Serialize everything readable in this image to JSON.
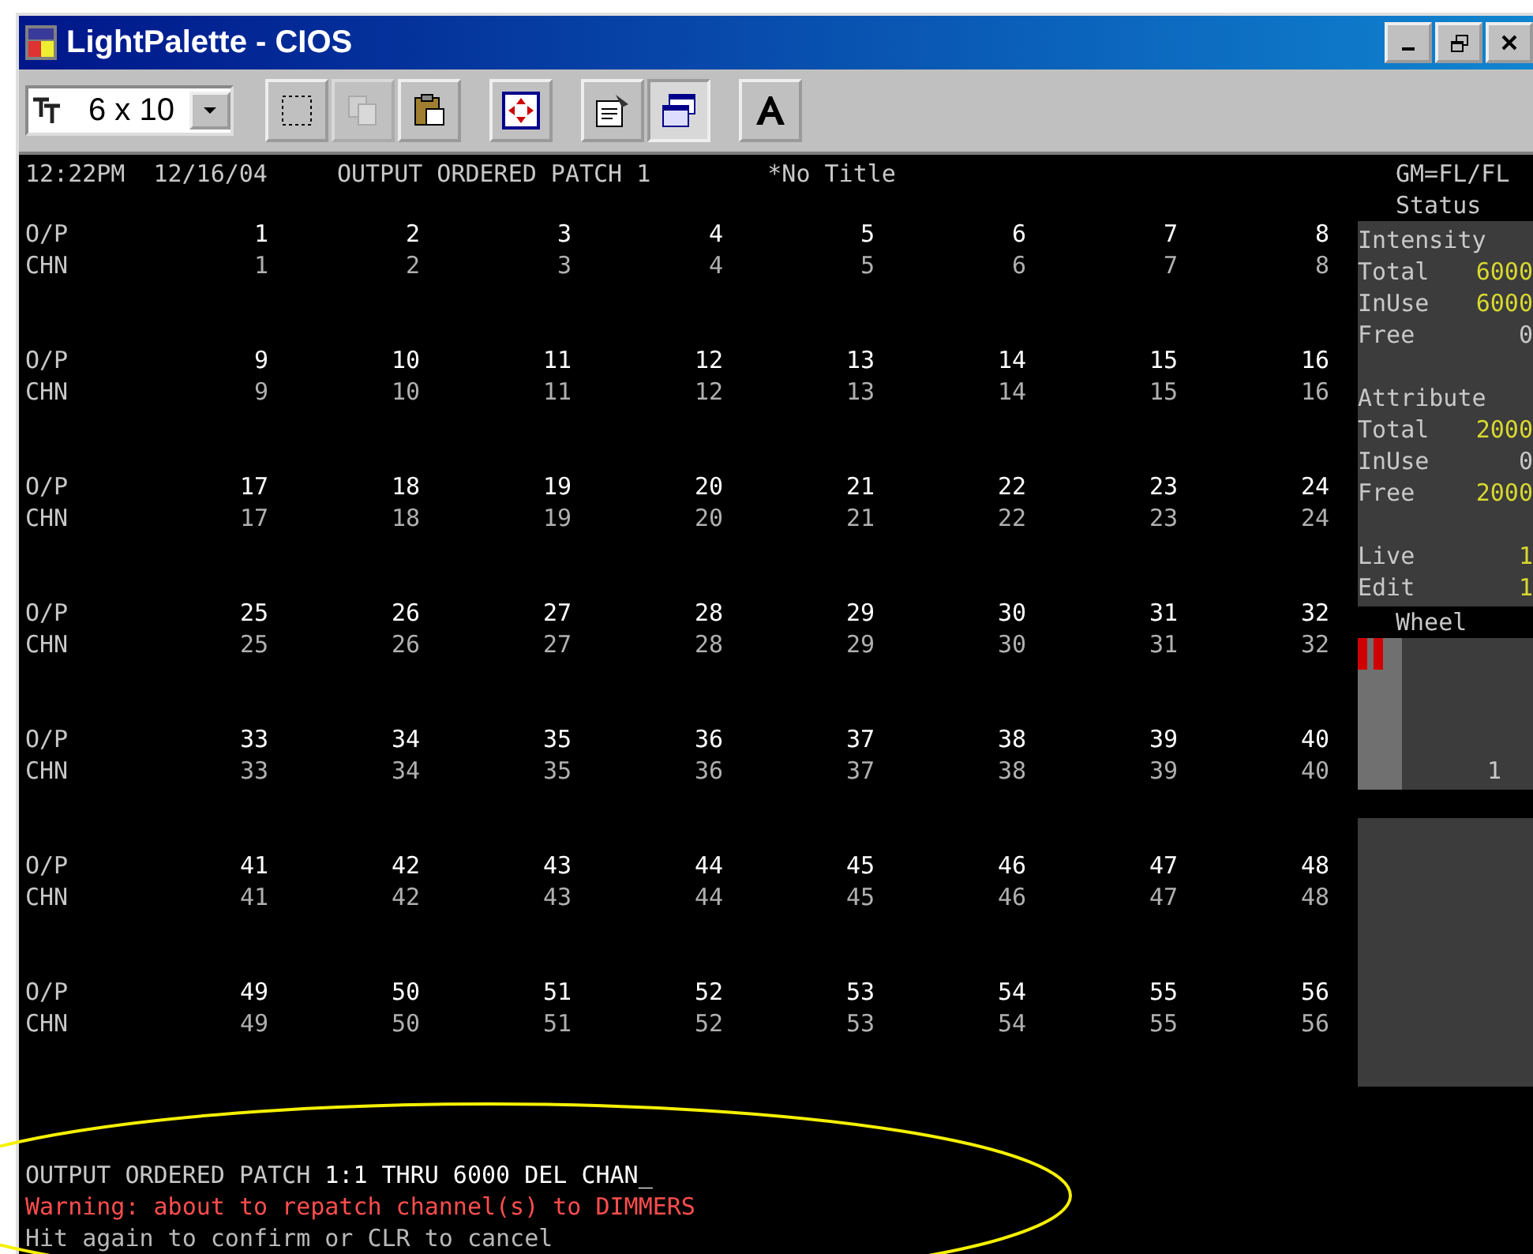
{
  "window": {
    "title": "LightPalette - CIOS"
  },
  "toolbar": {
    "font_size": "6 x 10",
    "buttons": [
      {
        "kind": "select",
        "disabled": false,
        "pressed": false
      },
      {
        "kind": "copy",
        "disabled": true,
        "pressed": false
      },
      {
        "kind": "paste",
        "disabled": false,
        "pressed": false
      },
      {
        "kind": "fullscreen",
        "disabled": false,
        "pressed": false
      },
      {
        "kind": "properties",
        "disabled": false,
        "pressed": false
      },
      {
        "kind": "background",
        "disabled": false,
        "pressed": true
      },
      {
        "kind": "font",
        "disabled": false,
        "pressed": false
      }
    ]
  },
  "header": {
    "time": "12:22PM",
    "date": "12/16/04",
    "screen": "OUTPUT ORDERED PATCH 1",
    "show_title": "*No Title",
    "grand_master": "GM=FL/FL"
  },
  "patch_rows": [
    {
      "op_label": "O/P",
      "chn_label": "CHN",
      "cells": [
        {
          "op": "1",
          "chn": "1"
        },
        {
          "op": "2",
          "chn": "2"
        },
        {
          "op": "3",
          "chn": "3"
        },
        {
          "op": "4",
          "chn": "4"
        },
        {
          "op": "5",
          "chn": "5"
        },
        {
          "op": "6",
          "chn": "6"
        },
        {
          "op": "7",
          "chn": "7"
        },
        {
          "op": "8",
          "chn": "8"
        }
      ]
    },
    {
      "op_label": "O/P",
      "chn_label": "CHN",
      "cells": [
        {
          "op": "9",
          "chn": "9"
        },
        {
          "op": "10",
          "chn": "10"
        },
        {
          "op": "11",
          "chn": "11"
        },
        {
          "op": "12",
          "chn": "12"
        },
        {
          "op": "13",
          "chn": "13"
        },
        {
          "op": "14",
          "chn": "14"
        },
        {
          "op": "15",
          "chn": "15"
        },
        {
          "op": "16",
          "chn": "16"
        }
      ]
    },
    {
      "op_label": "O/P",
      "chn_label": "CHN",
      "cells": [
        {
          "op": "17",
          "chn": "17"
        },
        {
          "op": "18",
          "chn": "18"
        },
        {
          "op": "19",
          "chn": "19"
        },
        {
          "op": "20",
          "chn": "20"
        },
        {
          "op": "21",
          "chn": "21"
        },
        {
          "op": "22",
          "chn": "22"
        },
        {
          "op": "23",
          "chn": "23"
        },
        {
          "op": "24",
          "chn": "24"
        }
      ]
    },
    {
      "op_label": "O/P",
      "chn_label": "CHN",
      "cells": [
        {
          "op": "25",
          "chn": "25"
        },
        {
          "op": "26",
          "chn": "26"
        },
        {
          "op": "27",
          "chn": "27"
        },
        {
          "op": "28",
          "chn": "28"
        },
        {
          "op": "29",
          "chn": "29"
        },
        {
          "op": "30",
          "chn": "30"
        },
        {
          "op": "31",
          "chn": "31"
        },
        {
          "op": "32",
          "chn": "32"
        }
      ]
    },
    {
      "op_label": "O/P",
      "chn_label": "CHN",
      "cells": [
        {
          "op": "33",
          "chn": "33"
        },
        {
          "op": "34",
          "chn": "34"
        },
        {
          "op": "35",
          "chn": "35"
        },
        {
          "op": "36",
          "chn": "36"
        },
        {
          "op": "37",
          "chn": "37"
        },
        {
          "op": "38",
          "chn": "38"
        },
        {
          "op": "39",
          "chn": "39"
        },
        {
          "op": "40",
          "chn": "40"
        }
      ]
    },
    {
      "op_label": "O/P",
      "chn_label": "CHN",
      "cells": [
        {
          "op": "41",
          "chn": "41"
        },
        {
          "op": "42",
          "chn": "42"
        },
        {
          "op": "43",
          "chn": "43"
        },
        {
          "op": "44",
          "chn": "44"
        },
        {
          "op": "45",
          "chn": "45"
        },
        {
          "op": "46",
          "chn": "46"
        },
        {
          "op": "47",
          "chn": "47"
        },
        {
          "op": "48",
          "chn": "48"
        }
      ]
    },
    {
      "op_label": "O/P",
      "chn_label": "CHN",
      "cells": [
        {
          "op": "49",
          "chn": "49"
        },
        {
          "op": "50",
          "chn": "50"
        },
        {
          "op": "51",
          "chn": "51"
        },
        {
          "op": "52",
          "chn": "52"
        },
        {
          "op": "53",
          "chn": "53"
        },
        {
          "op": "54",
          "chn": "54"
        },
        {
          "op": "55",
          "chn": "55"
        },
        {
          "op": "56",
          "chn": "56"
        }
      ]
    }
  ],
  "status_panel": {
    "title": "Status",
    "lines": [
      {
        "kind": "heading",
        "label": "Intensity"
      },
      {
        "kind": "value",
        "label": "Total",
        "value": "6000",
        "highlight": true
      },
      {
        "kind": "value",
        "label": "InUse",
        "value": "6000",
        "highlight": true
      },
      {
        "kind": "value",
        "label": "Free",
        "value": "0",
        "highlight": false
      },
      {
        "kind": "gap"
      },
      {
        "kind": "heading",
        "label": "Attribute"
      },
      {
        "kind": "value",
        "label": "Total",
        "value": "2000",
        "highlight": true
      },
      {
        "kind": "value",
        "label": "InUse",
        "value": "0",
        "highlight": false
      },
      {
        "kind": "value",
        "label": "Free",
        "value": "2000",
        "highlight": true
      },
      {
        "kind": "gap"
      },
      {
        "kind": "value",
        "label": "Live",
        "value": "1",
        "highlight": true
      },
      {
        "kind": "value",
        "label": "Edit",
        "value": "1",
        "highlight": true
      }
    ]
  },
  "wheel": {
    "title": "Wheel",
    "value": "1",
    "level": 0.25
  },
  "command_line": {
    "prompt": "OUTPUT ORDERED PATCH ",
    "input": "1:1 THRU 6000 DEL CHAN_"
  },
  "messages": [
    {
      "kind": "warning",
      "text": "Warning: about to repatch channel(s) to DIMMERS"
    },
    {
      "kind": "hint",
      "text": "Hit again to confirm or CLR to cancel"
    }
  ]
}
